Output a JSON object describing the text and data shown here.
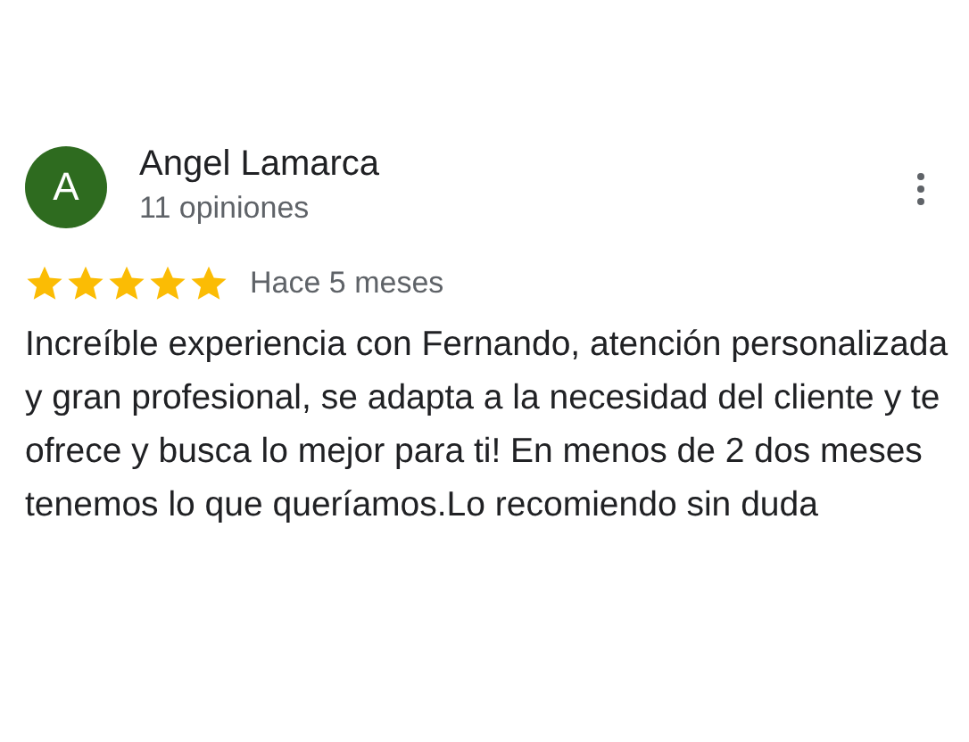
{
  "review": {
    "avatar_letter": "A",
    "color": "#2e6b1f",
    "author": "Angel Lamarca",
    "author_reviews": "11 opiniones",
    "stars": 5,
    "time": "Hace 5 meses",
    "text": "Increíble experiencia con Fernando, atención personalizada y gran profesional, se adapta a la necesidad del cliente y te ofrece y busca lo mejor para ti! En menos de 2 dos meses tenemos lo que queríamos.Lo recomiendo sin duda"
  }
}
